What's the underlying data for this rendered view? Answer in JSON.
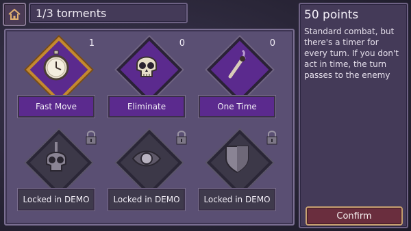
{
  "header": {
    "title": "1/3 torments"
  },
  "side": {
    "points": "50 points",
    "description": "Standard combat, but there's a timer for every turn. If you don't act in time, the turn passes to the enemy",
    "confirm_label": "Confirm"
  },
  "cards": [
    {
      "label": "Fast Move",
      "count": "1",
      "icon": "stopwatch-icon",
      "selected": true,
      "locked": false
    },
    {
      "label": "Eliminate",
      "count": "0",
      "icon": "skull-icon",
      "selected": false,
      "locked": false
    },
    {
      "label": "One Time",
      "count": "0",
      "icon": "match-icon",
      "selected": false,
      "locked": false
    },
    {
      "label": "Locked in DEMO",
      "icon": "skull-dagger-icon",
      "locked": true
    },
    {
      "label": "Locked in DEMO",
      "icon": "eye-icon",
      "locked": true
    },
    {
      "label": "Locked in DEMO",
      "icon": "shield-icon",
      "locked": true
    }
  ],
  "colors": {
    "accent_purple": "#5b2a8e",
    "selected_gold": "#c48a2e",
    "confirm_bg": "#6a2e3e"
  }
}
